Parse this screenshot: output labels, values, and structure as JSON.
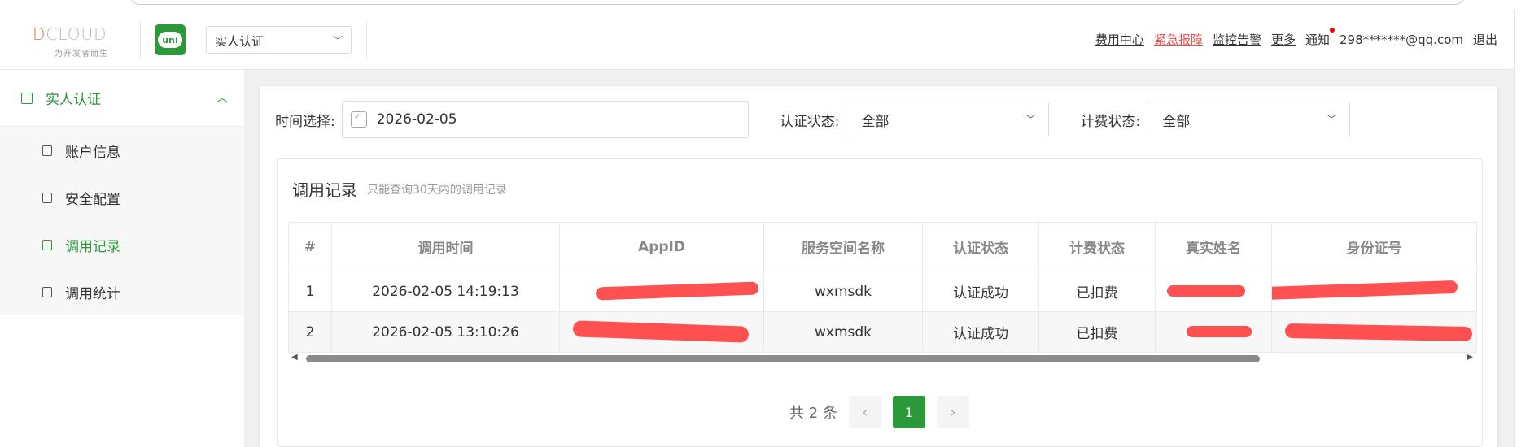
{
  "header": {
    "logo_text": "DCLOUD",
    "logo_slogan": "为开发者而生",
    "uni_label": "uni",
    "product_select": "实人认证",
    "links": {
      "fee_center": "费用中心",
      "emergency": "紧急报障",
      "monitor": "监控告警",
      "more": "更多",
      "notify": "通知",
      "account": "298*******@qq.com",
      "logout": "退出"
    }
  },
  "sidebar": {
    "group": "实人认证",
    "items": [
      {
        "label": "账户信息"
      },
      {
        "label": "安全配置"
      },
      {
        "label": "调用记录"
      },
      {
        "label": "调用统计"
      }
    ]
  },
  "filters": {
    "time_label": "时间选择:",
    "date_value": "2026-02-05",
    "auth_label": "认证状态:",
    "auth_value": "全部",
    "bill_label": "计费状态:",
    "bill_value": "全部"
  },
  "records": {
    "title": "调用记录",
    "subtitle": "只能查询30天内的调用记录",
    "columns": [
      "#",
      "调用时间",
      "AppID",
      "服务空间名称",
      "认证状态",
      "计费状态",
      "真实姓名",
      "身份证号"
    ],
    "rows": [
      {
        "no": "1",
        "time": "2026-02-05 14:19:13",
        "space": "wxmsdk",
        "auth": "认证成功",
        "bill": "已扣费"
      },
      {
        "no": "2",
        "time": "2026-02-05 13:10:26",
        "space": "wxmsdk",
        "auth": "认证成功",
        "bill": "已扣费"
      }
    ]
  },
  "pager": {
    "total": "共 2 条",
    "prev": "‹",
    "current": "1",
    "next": "›"
  },
  "colors": {
    "accent": "#2b9939",
    "danger": "#dd524d"
  }
}
